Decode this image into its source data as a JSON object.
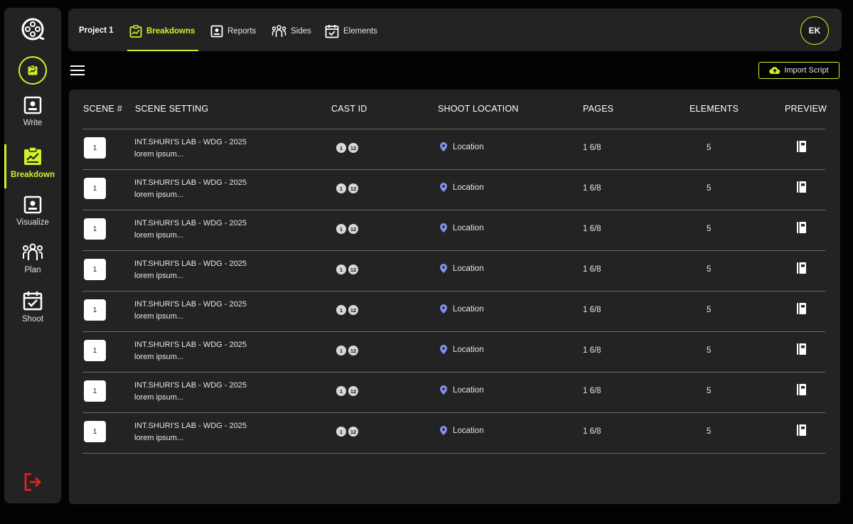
{
  "colors": {
    "accent": "#d4f02b",
    "background": "#030303",
    "surface": "#232323",
    "danger": "#e0231f"
  },
  "sidebar": {
    "items": [
      {
        "label": "Write",
        "icon": "user-square-icon"
      },
      {
        "label": "Breakdown",
        "icon": "chart-clipboard-icon",
        "active": true
      },
      {
        "label": "Visualize",
        "icon": "user-square-icon"
      },
      {
        "label": "Plan",
        "icon": "people-group-icon"
      },
      {
        "label": "Shoot",
        "icon": "calendar-check-icon"
      }
    ]
  },
  "topbar": {
    "project": "Project 1",
    "tabs": [
      {
        "label": "Breakdowns",
        "icon": "chart-clipboard-icon",
        "active": true
      },
      {
        "label": "Reports",
        "icon": "user-square-icon"
      },
      {
        "label": "Sides",
        "icon": "people-group-icon"
      },
      {
        "label": "Elements",
        "icon": "calendar-check-icon"
      }
    ],
    "avatar": "EK"
  },
  "toolbar": {
    "import_label": "Import Script"
  },
  "table": {
    "headers": {
      "scene": "SCENE #",
      "setting": "SCENE SETTING",
      "cast": "CAST ID",
      "location": "SHOOT LOCATION",
      "pages": "PAGES",
      "elements": "ELEMENTS",
      "preview": "PREVIEW"
    },
    "rows": [
      {
        "scene": "1",
        "setting": "INT.SHURI'S LAB - WDG - 2025",
        "description": "lorem ipsum...",
        "cast": [
          "1",
          "12"
        ],
        "location": "Location",
        "pages": "1 6/8",
        "elements": "5"
      },
      {
        "scene": "1",
        "setting": "INT.SHURI'S LAB - WDG - 2025",
        "description": "lorem ipsum...",
        "cast": [
          "1",
          "12"
        ],
        "location": "Location",
        "pages": "1 6/8",
        "elements": "5"
      },
      {
        "scene": "1",
        "setting": "INT.SHURI'S LAB - WDG - 2025",
        "description": "lorem ipsum...",
        "cast": [
          "1",
          "12"
        ],
        "location": "Location",
        "pages": "1 6/8",
        "elements": "5"
      },
      {
        "scene": "1",
        "setting": "INT.SHURI'S LAB - WDG - 2025",
        "description": "lorem ipsum...",
        "cast": [
          "1",
          "12"
        ],
        "location": "Location",
        "pages": "1 6/8",
        "elements": "5"
      },
      {
        "scene": "1",
        "setting": "INT.SHURI'S LAB - WDG - 2025",
        "description": "lorem ipsum...",
        "cast": [
          "1",
          "12"
        ],
        "location": "Location",
        "pages": "1 6/8",
        "elements": "5"
      },
      {
        "scene": "1",
        "setting": "INT.SHURI'S LAB - WDG - 2025",
        "description": "lorem ipsum...",
        "cast": [
          "1",
          "12"
        ],
        "location": "Location",
        "pages": "1 6/8",
        "elements": "5"
      },
      {
        "scene": "1",
        "setting": "INT.SHURI'S LAB - WDG - 2025",
        "description": "lorem ipsum...",
        "cast": [
          "1",
          "12"
        ],
        "location": "Location",
        "pages": "1 6/8",
        "elements": "5"
      },
      {
        "scene": "1",
        "setting": "INT.SHURI'S LAB - WDG - 2025",
        "description": "lorem ipsum...",
        "cast": [
          "1",
          "12"
        ],
        "location": "Location",
        "pages": "1 6/8",
        "elements": "5"
      }
    ]
  }
}
